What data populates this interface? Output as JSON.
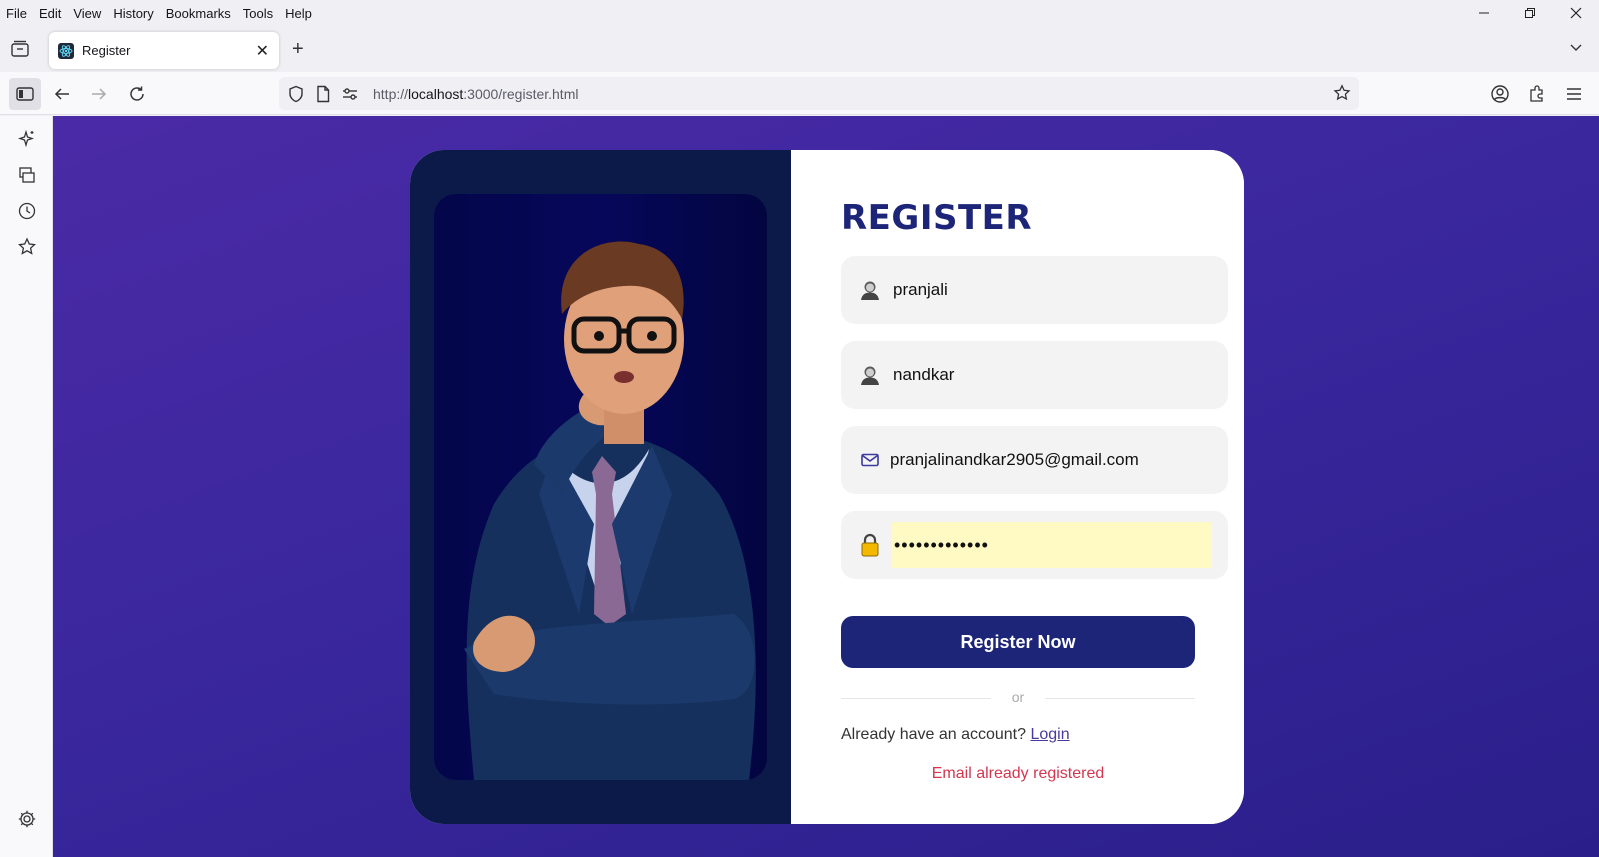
{
  "menu": [
    "File",
    "Edit",
    "View",
    "History",
    "Bookmarks",
    "Tools",
    "Help"
  ],
  "tab": {
    "title": "Register"
  },
  "url": {
    "prefix": "http://",
    "host": "localhost",
    "rest": ":3000/register.html"
  },
  "form": {
    "title": "REGISTER",
    "first_name": "pranjali",
    "last_name": "nandkar",
    "email": "pranjalinandkar2905@gmail.com",
    "password_masked": "•••••••••••••",
    "submit_label": "Register Now",
    "divider_text": "or",
    "login_prompt": "Already have an account?",
    "login_link": "Login",
    "error_message": "Email already registered"
  },
  "colors": {
    "accent": "#1d2579",
    "error": "#d3364f",
    "background": "#3a279e"
  }
}
